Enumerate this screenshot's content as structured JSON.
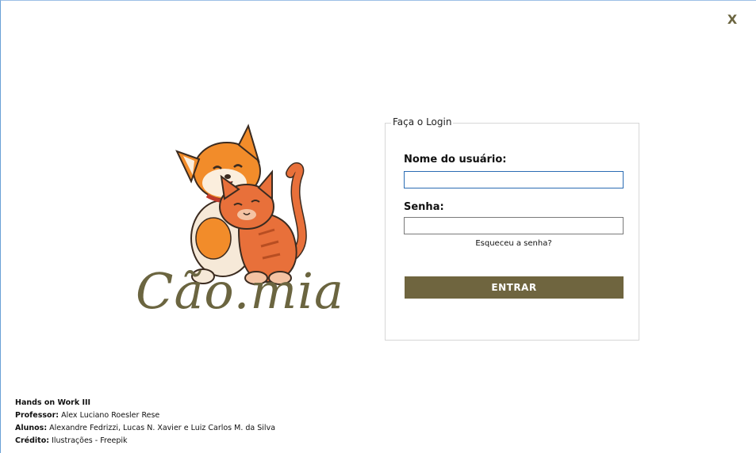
{
  "window": {
    "close_label": "X"
  },
  "logo": {
    "text": "Cão.mia",
    "icon": "dog-and-cat-illustration"
  },
  "login": {
    "legend": "Faça o Login",
    "username_label": "Nome do usuário:",
    "username_value": "",
    "password_label": "Senha:",
    "password_value": "",
    "forgot_label": "Esqueceu a senha?",
    "submit_label": "ENTRAR"
  },
  "credits": {
    "title": "Hands on Work III",
    "professor_key": "Professor:",
    "professor_value": "Alex Luciano Roesler Rese",
    "students_key": "Alunos:",
    "students_value": "Alexandre Fedrizzi, Lucas N. Xavier e Luiz Carlos M. da Silva",
    "credit_key": "Crédito:",
    "credit_value": "Ilustrações - Freepik"
  },
  "colors": {
    "accent": "#6f653f",
    "dog": "#f28c2a",
    "cat": "#e8703a",
    "focus_border": "#2b6cb3"
  }
}
